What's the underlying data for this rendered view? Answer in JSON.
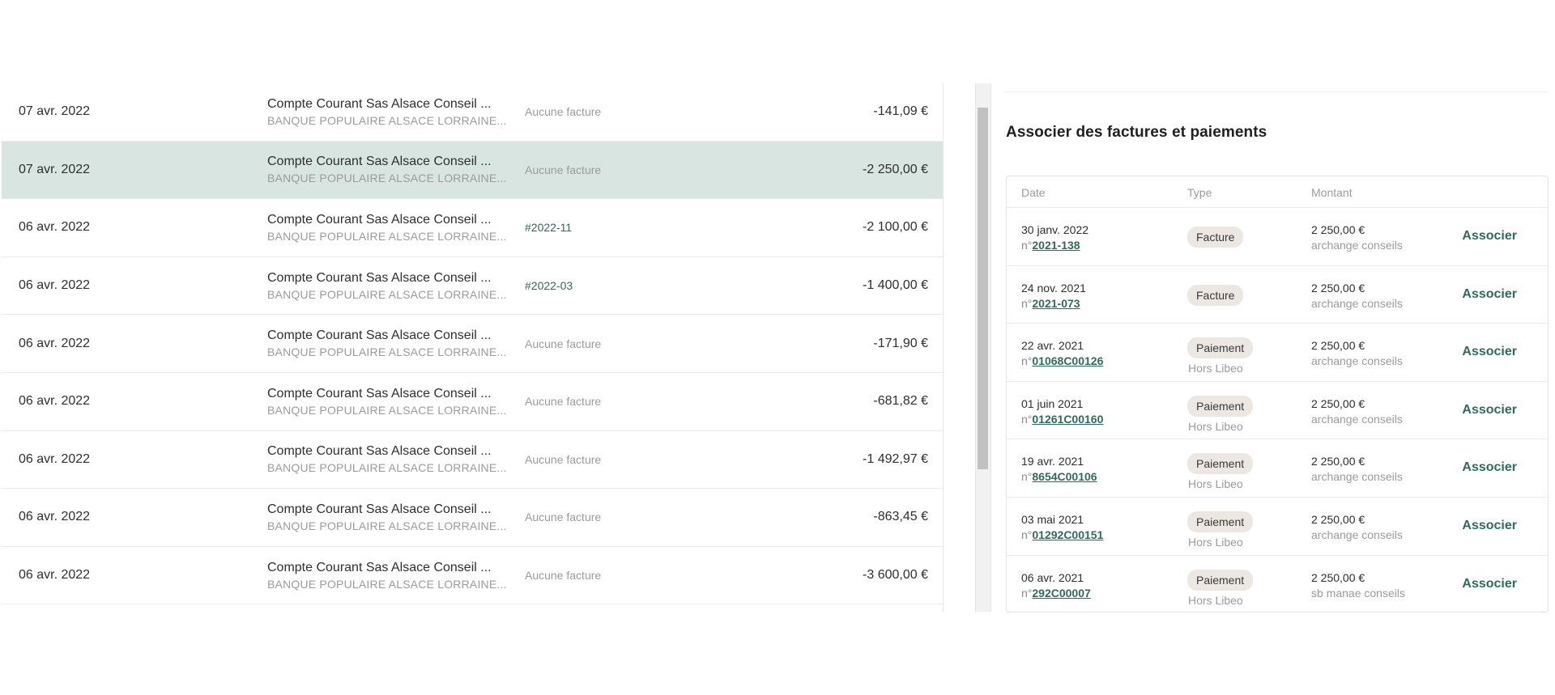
{
  "transactions": [
    {
      "date": "07 avr. 2022",
      "account": "Compte Courant Sas Alsace Conseil ...",
      "bank": "BANQUE POPULAIRE ALSACE LORRAINE...",
      "invoice": "Aucune facture",
      "amount": "-141,09 €",
      "selected": false
    },
    {
      "date": "07 avr. 2022",
      "account": "Compte Courant Sas Alsace Conseil ...",
      "bank": "BANQUE POPULAIRE ALSACE LORRAINE...",
      "invoice": "Aucune facture",
      "amount": "-2 250,00 €",
      "selected": true
    },
    {
      "date": "06 avr. 2022",
      "account": "Compte Courant Sas Alsace Conseil ...",
      "bank": "BANQUE POPULAIRE ALSACE LORRAINE...",
      "invoice": "#2022-11",
      "amount": "-2 100,00 €",
      "selected": false
    },
    {
      "date": "06 avr. 2022",
      "account": "Compte Courant Sas Alsace Conseil ...",
      "bank": "BANQUE POPULAIRE ALSACE LORRAINE...",
      "invoice": "#2022-03",
      "amount": "-1 400,00 €",
      "selected": false
    },
    {
      "date": "06 avr. 2022",
      "account": "Compte Courant Sas Alsace Conseil ...",
      "bank": "BANQUE POPULAIRE ALSACE LORRAINE...",
      "invoice": "Aucune facture",
      "amount": "-171,90 €",
      "selected": false
    },
    {
      "date": "06 avr. 2022",
      "account": "Compte Courant Sas Alsace Conseil ...",
      "bank": "BANQUE POPULAIRE ALSACE LORRAINE...",
      "invoice": "Aucune facture",
      "amount": "-681,82 €",
      "selected": false
    },
    {
      "date": "06 avr. 2022",
      "account": "Compte Courant Sas Alsace Conseil ...",
      "bank": "BANQUE POPULAIRE ALSACE LORRAINE...",
      "invoice": "Aucune facture",
      "amount": "-1 492,97 €",
      "selected": false
    },
    {
      "date": "06 avr. 2022",
      "account": "Compte Courant Sas Alsace Conseil ...",
      "bank": "BANQUE POPULAIRE ALSACE LORRAINE...",
      "invoice": "Aucune facture",
      "amount": "-863,45 €",
      "selected": false
    },
    {
      "date": "06 avr. 2022",
      "account": "Compte Courant Sas Alsace Conseil ...",
      "bank": "BANQUE POPULAIRE ALSACE LORRAINE...",
      "invoice": "Aucune facture",
      "amount": "-3 600,00 €",
      "selected": false
    }
  ],
  "associate": {
    "title": "Associer des factures et paiements",
    "headers": {
      "date": "Date",
      "type": "Type",
      "amount": "Montant"
    },
    "rows": [
      {
        "date": "30 janv. 2022",
        "num_prefix": "n°",
        "num": "2021-138",
        "type": "Facture",
        "type_sub": "",
        "amount": "2 250,00 €",
        "client": "archange conseils",
        "action": "Associer"
      },
      {
        "date": "24 nov. 2021",
        "num_prefix": "n°",
        "num": "2021-073",
        "type": "Facture",
        "type_sub": "",
        "amount": "2 250,00 €",
        "client": "archange conseils",
        "action": "Associer"
      },
      {
        "date": "22 avr. 2021",
        "num_prefix": "n°",
        "num": "01068C00126",
        "type": "Paiement",
        "type_sub": "Hors Libeo",
        "amount": "2 250,00 €",
        "client": "archange conseils",
        "action": "Associer"
      },
      {
        "date": "01 juin 2021",
        "num_prefix": "n°",
        "num": "01261C00160",
        "type": "Paiement",
        "type_sub": "Hors Libeo",
        "amount": "2 250,00 €",
        "client": "archange conseils",
        "action": "Associer"
      },
      {
        "date": "19 avr. 2021",
        "num_prefix": "n°",
        "num": "8654C00106",
        "type": "Paiement",
        "type_sub": "Hors Libeo",
        "amount": "2 250,00 €",
        "client": "archange conseils",
        "action": "Associer"
      },
      {
        "date": "03 mai 2021",
        "num_prefix": "n°",
        "num": "01292C00151",
        "type": "Paiement",
        "type_sub": "Hors Libeo",
        "amount": "2 250,00 €",
        "client": "archange conseils",
        "action": "Associer"
      },
      {
        "date": "06 avr. 2021",
        "num_prefix": "n°",
        "num": "292C00007",
        "type": "Paiement",
        "type_sub": "Hors Libeo",
        "amount": "2 250,00 €",
        "client": "sb manae conseils",
        "action": "Associer"
      }
    ]
  },
  "colors": {
    "selected_row": "#d9e5e1",
    "accent": "#2f6b5c",
    "pill": "#ece7e0"
  }
}
